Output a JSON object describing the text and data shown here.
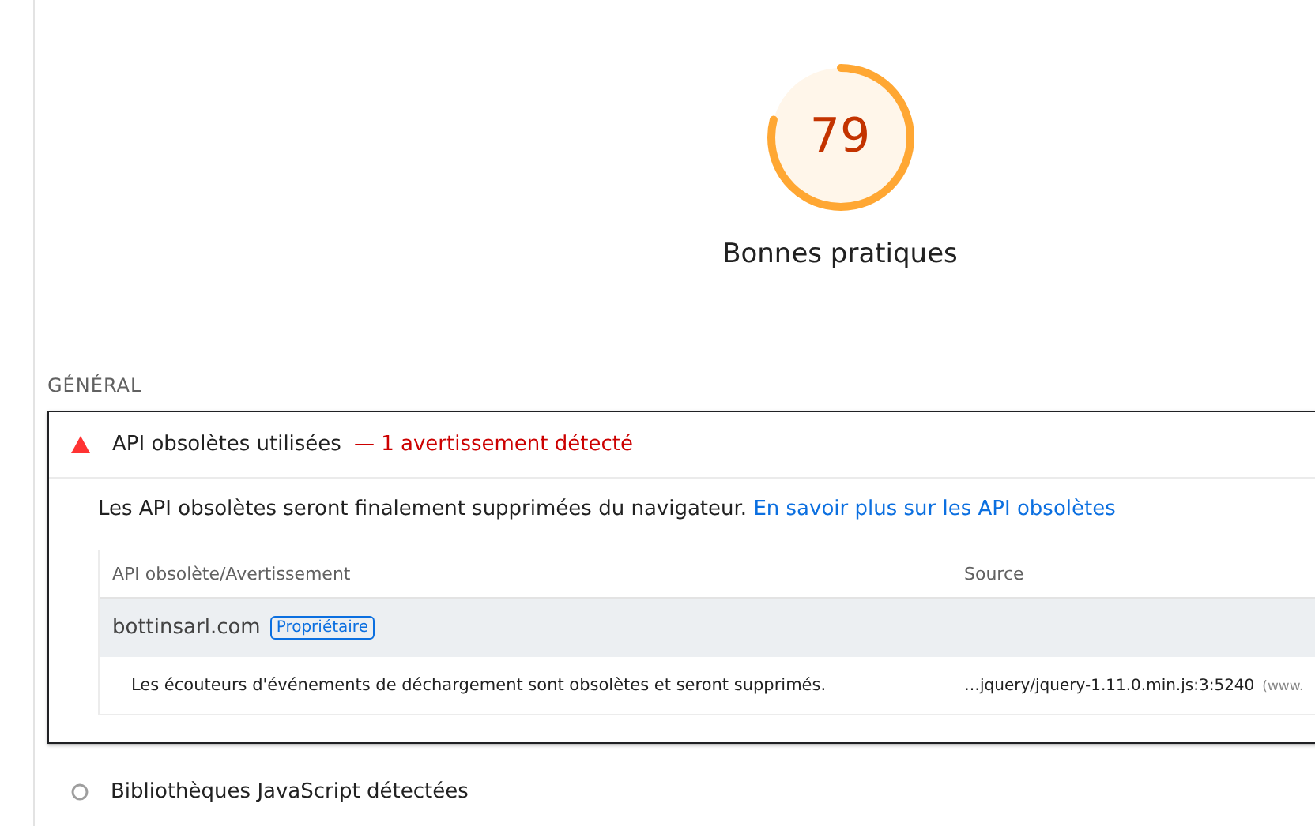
{
  "score": {
    "value": "79",
    "title": "Bonnes pratiques"
  },
  "section": "GÉNÉRAL",
  "audits": [
    {
      "kind": "warning",
      "title": "API obsolètes utilisées",
      "summary": "— 1 avertissement détecté",
      "expanded": true,
      "description": "Les API obsolètes seront finalement supprimées du navigateur.",
      "link": "En savoir plus sur les API obsolètes",
      "table": {
        "columns": [
          "API obsolète/Avertissement",
          "Source"
        ],
        "groups": [
          {
            "domain": "bottinsarl.com",
            "badge": "Propriétaire",
            "items": [
              {
                "text": "Les écouteurs d'événements de déchargement sont obsolètes et seront supprimés.",
                "source": "…jquery/jquery-1.11.0.min.js:3:5240",
                "host": "(www."
              }
            ]
          }
        ]
      }
    },
    {
      "kind": "info",
      "title": "Bibliothèques JavaScript détectées",
      "expanded": false
    }
  ]
}
